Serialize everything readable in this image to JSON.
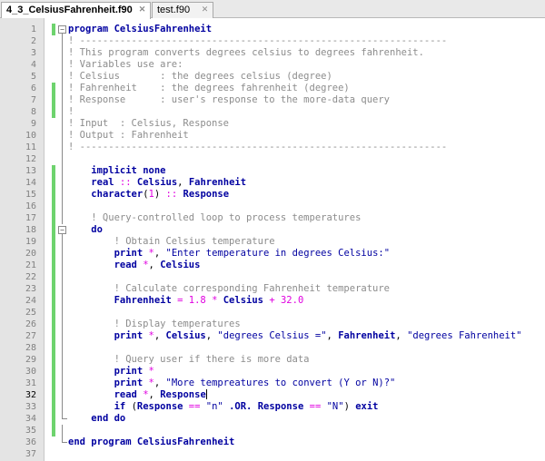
{
  "tabs": [
    {
      "label": "4_3_CelsiusFahrenheit.f90",
      "active": true
    },
    {
      "label": "test.f90",
      "active": false
    }
  ],
  "lines": [
    {
      "n": "1",
      "t": "program CelsiusFahrenheit"
    },
    {
      "n": "2",
      "t": "! ----------------------------------------------------------------"
    },
    {
      "n": "3",
      "t": "! This program converts degrees celsius to degrees fahrenheit."
    },
    {
      "n": "4",
      "t": "! Variables use are:"
    },
    {
      "n": "5",
      "t": "! Celsius       : the degrees celsius (degree)"
    },
    {
      "n": "6",
      "t": "! Fahrenheit    : the degrees fahrenheit (degree)"
    },
    {
      "n": "7",
      "t": "! Response      : user's response to the more-data query"
    },
    {
      "n": "8",
      "t": "!"
    },
    {
      "n": "9",
      "t": "! Input  : Celsius, Response"
    },
    {
      "n": "10",
      "t": "! Output : Fahrenheit"
    },
    {
      "n": "11",
      "t": "! ----------------------------------------------------------------"
    },
    {
      "n": "12",
      "t": ""
    },
    {
      "n": "13",
      "t": "    implicit none"
    },
    {
      "n": "14",
      "t": "    real :: Celsius, Fahrenheit"
    },
    {
      "n": "15",
      "t": "    character(1) :: Response"
    },
    {
      "n": "16",
      "t": ""
    },
    {
      "n": "17",
      "t": "    ! Query-controlled loop to process temperatures"
    },
    {
      "n": "18",
      "t": "    do"
    },
    {
      "n": "19",
      "t": "        ! Obtain Celsius temperature"
    },
    {
      "n": "20",
      "t": "        print *, \"Enter temperature in degrees Celsius:\""
    },
    {
      "n": "21",
      "t": "        read *, Celsius"
    },
    {
      "n": "22",
      "t": ""
    },
    {
      "n": "23",
      "t": "        ! Calculate corresponding Fahrenheit temperature"
    },
    {
      "n": "24",
      "t": "        Fahrenheit = 1.8 * Celsius + 32.0"
    },
    {
      "n": "25",
      "t": ""
    },
    {
      "n": "26",
      "t": "        ! Display temperatures"
    },
    {
      "n": "27",
      "t": "        print *, Celsius, \"degrees Celsius =\", Fahrenheit, \"degrees Fahrenheit\""
    },
    {
      "n": "28",
      "t": ""
    },
    {
      "n": "29",
      "t": "        ! Query user if there is more data"
    },
    {
      "n": "30",
      "t": "        print *"
    },
    {
      "n": "31",
      "t": "        print *, \"More tempreatures to convert (Y or N)?\""
    },
    {
      "n": "32",
      "t": "        read *, Response"
    },
    {
      "n": "33",
      "t": "        if (Response == \"n\" .OR. Response == \"N\") exit"
    },
    {
      "n": "34",
      "t": "    end do"
    },
    {
      "n": "35",
      "t": ""
    },
    {
      "n": "36",
      "t": "end program CelsiusFahrenheit"
    },
    {
      "n": "37",
      "t": ""
    }
  ]
}
